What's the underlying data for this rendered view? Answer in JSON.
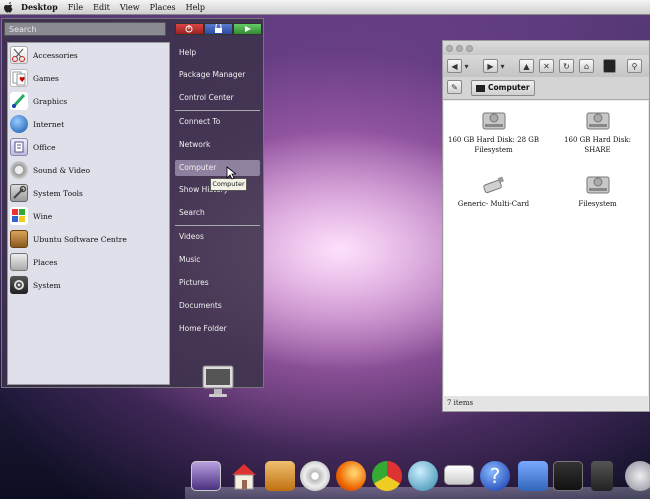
{
  "menubar": {
    "app": "Desktop",
    "items": [
      "File",
      "Edit",
      "View",
      "Places",
      "Help"
    ]
  },
  "startmenu": {
    "search_placeholder": "Search",
    "categories": [
      "Accessories",
      "Games",
      "Graphics",
      "Internet",
      "Office",
      "Sound & Video",
      "System Tools",
      "Wine",
      "Ubuntu Software Centre",
      "Places",
      "System"
    ],
    "places": [
      "Help",
      "Package Manager",
      "Control Center",
      "Connect To",
      "Network",
      "Computer",
      "Show History",
      "Search",
      "Videos",
      "Music",
      "Pictures",
      "Documents",
      "Home Folder"
    ],
    "tooltip": "Computer"
  },
  "filemanager": {
    "location": "Computer",
    "items": [
      {
        "label": "160 GB Hard Disk: 28 GB Filesystem"
      },
      {
        "label": "160 GB Hard Disk: SHARE"
      },
      {
        "label": "Generic- Multi-Card"
      },
      {
        "label": "Filesystem"
      }
    ],
    "status": "7 items"
  },
  "dock": {
    "icons": [
      "photo-app-icon",
      "home-icon",
      "downloads-icon",
      "cd-icon",
      "firefox-icon",
      "chrome-icon",
      "network-globe-icon",
      "mail-icon",
      "help-icon",
      "finder-icon",
      "clapper-icon",
      "ipod-icon",
      "weather-icon"
    ]
  }
}
